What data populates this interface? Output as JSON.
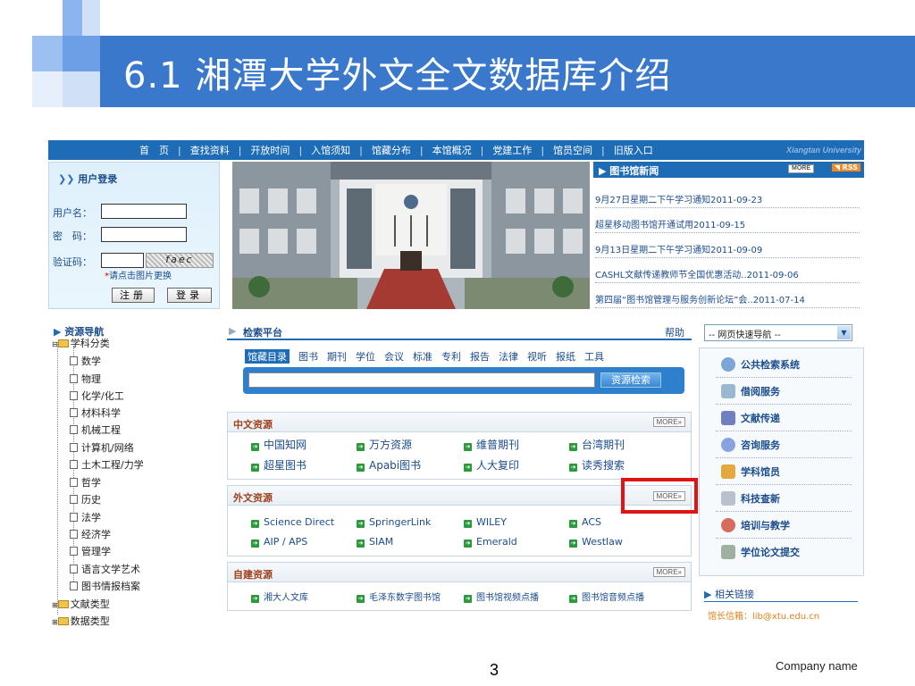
{
  "slide": {
    "title": "6.1 湘潭大学外文全文数据库介绍",
    "page_number": "3",
    "company": "Company name"
  },
  "nav": {
    "items": [
      "首　页",
      "查找资料",
      "开放时间",
      "入馆须知",
      "馆藏分布",
      "本馆概况",
      "党建工作",
      "馆员空间",
      "旧版入口"
    ],
    "brand": "Xiangtan University"
  },
  "login": {
    "title": "用户登录",
    "username_label": "用户名：",
    "password_label": "密　码：",
    "captcha_label": "验证码：",
    "captcha_text": "faec",
    "captcha_hint": "请点击图片更换",
    "register_button": "注册",
    "login_button": "登录"
  },
  "news": {
    "title": "图书馆新闻",
    "more": "MORE",
    "rss": "RSS",
    "items": [
      "9月27日星期二下午学习通知2011-09-23",
      "超星移动图书馆开通试用2011-09-15",
      "9月13日星期二下午学习通知2011-09-09",
      "CASHL文献传递教师节全国优惠活动..2011-09-06",
      "第四届“图书馆管理与服务创新论坛”会..2011-07-14"
    ]
  },
  "resource_nav": {
    "title": "资源导航",
    "root": "学科分类",
    "items": [
      "数学",
      "物理",
      "化学/化工",
      "材料科学",
      "机械工程",
      "计算机/网络",
      "土木工程/力学",
      "哲学",
      "历史",
      "法学",
      "经济学",
      "管理学",
      "语言文学艺术",
      "图书情报档案"
    ],
    "folders": [
      "文献类型",
      "数据类型"
    ]
  },
  "search": {
    "title": "检索平台",
    "help": "帮助",
    "tabs": [
      "馆藏目录",
      "图书",
      "期刊",
      "学位",
      "会议",
      "标准",
      "专利",
      "报告",
      "法律",
      "视听",
      "报纸",
      "工具"
    ],
    "button": "资源检索"
  },
  "chinese_resources": {
    "title": "中文资源",
    "more": "MORE",
    "links": [
      "中国知网",
      "万方资源",
      "维普期刊",
      "台湾期刊",
      "超星图书",
      "Apabi图书",
      "人大复印",
      "读秀搜索"
    ]
  },
  "foreign_resources": {
    "title": "外文资源",
    "more": "MORE",
    "links": [
      "Science Direct",
      "SpringerLink",
      "WILEY",
      "ACS",
      "AIP / APS",
      "SIAM",
      "Emerald",
      "Westlaw"
    ]
  },
  "own_resources": {
    "title": "自建资源",
    "more": "MORE",
    "links": [
      "湘大人文库",
      "毛泽东数字图书馆",
      "图书馆视频点播",
      "图书馆音频点播"
    ]
  },
  "quick_nav": {
    "select_value": "-- 网页快速导航 --",
    "services": [
      "公共检索系统",
      "借阅服务",
      "文献传递",
      "咨询服务",
      "学科馆员",
      "科技查新",
      "培训与教学",
      "学位论文提交"
    ],
    "related_links": "相关链接",
    "mailbox": "馆长信箱：lib@xtu.edu.cn"
  },
  "colors": {
    "title_band": "#3a78cc",
    "nav": "#1d6cb5",
    "highlight": "#e01414"
  }
}
